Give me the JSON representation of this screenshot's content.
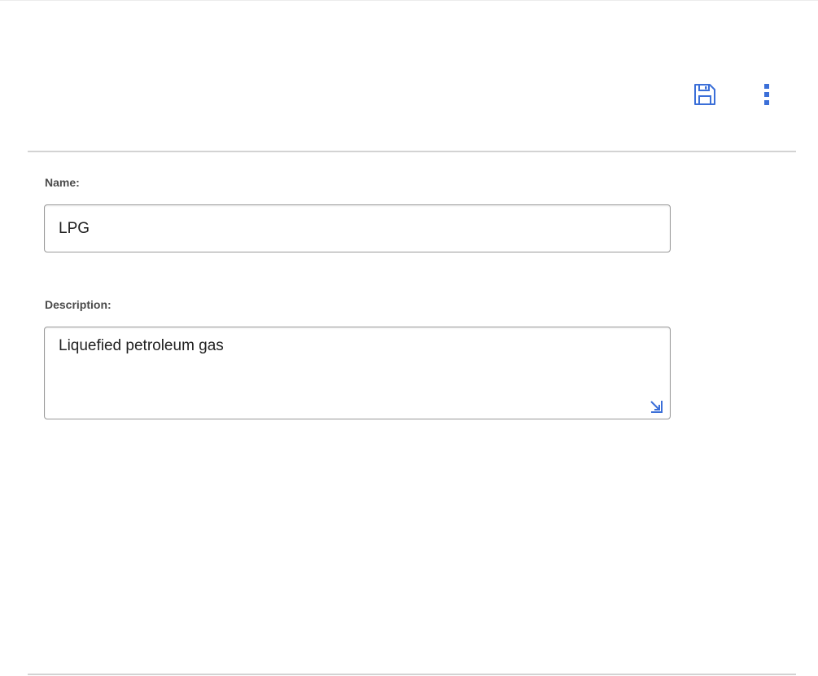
{
  "toolbar": {
    "save_icon": "save-icon",
    "more_icon": "more-vertical-icon",
    "accent_color": "#3b6fd8"
  },
  "form": {
    "name": {
      "label": "Name:",
      "value": "LPG"
    },
    "description": {
      "label": "Description:",
      "value": "Liquefied petroleum gas",
      "resize_icon": "resize-handle-icon"
    }
  }
}
